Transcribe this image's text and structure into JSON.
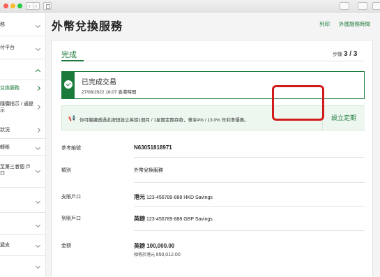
{
  "chrome": {
    "nav_back": "‹",
    "nav_fwd": "›"
  },
  "sidebar": {
    "items": [
      {
        "label": "務",
        "expanded": false
      },
      {
        "label": "付平台",
        "expanded": false
      },
      {
        "label": "",
        "expanded": true
      },
      {
        "label": "兌換服務",
        "active": true
      },
      {
        "label": "隨價指示 / 通提示",
        "active": false
      },
      {
        "label": "狀況",
        "active": false
      },
      {
        "label": "轉賬",
        "expanded": false
      },
      {
        "label": "至第三者個 戶口",
        "expanded": false
      },
      {
        "label": "",
        "expanded": false
      },
      {
        "label": "",
        "expanded": false
      },
      {
        "label": "遞支",
        "expanded": false
      },
      {
        "label": "",
        "expanded": false
      }
    ]
  },
  "header": {
    "title": "外幣兌換服務",
    "print_link": "列印",
    "hours_link": "外匯服務時間"
  },
  "card": {
    "section_title": "完成",
    "step_prefix": "步驟",
    "step_value": "3 / 3",
    "success": {
      "title": "已完成交易",
      "timestamp": "27/06/2022 16:07 香港時間"
    },
    "promo": {
      "text": "你可繼續透過此按鈕設立英鎊1個月 / 1星期定期存款，尊享4% / 13.0% 年利率優惠。",
      "button": "設立定期"
    },
    "details": [
      {
        "label": "參考編號",
        "value": "N63051818971"
      },
      {
        "label": "類別",
        "value": "外幣兌換服務"
      },
      {
        "label": "支賬戶口",
        "value_bold": "港元",
        "value": " 123-456789-888 HKD Savings"
      },
      {
        "label": "到賬戶口",
        "value_bold": "英鎊",
        "value": " 123-456789-888 GBP Savings"
      },
      {
        "label": "金額",
        "value_bold": "英鎊 100,000.00",
        "sub_prefix": "相等於港元 ",
        "sub_value": "950,012.00"
      }
    ]
  },
  "colors": {
    "brand_green": "#1a7a3a",
    "highlight_red": "#d11a1a",
    "promo_bg": "#eef7ef"
  }
}
